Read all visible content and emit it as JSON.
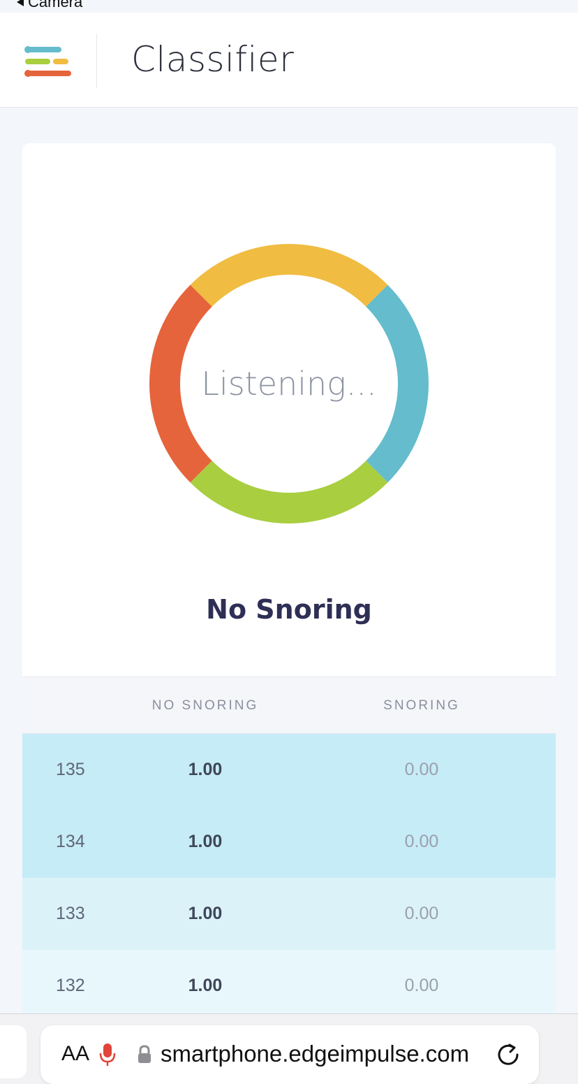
{
  "status_bar": {
    "back_label": "Camera"
  },
  "header": {
    "title": "Classifier"
  },
  "classifier": {
    "ring_text": "Listening...",
    "result_label": "No Snoring",
    "ring_colors": [
      "#f0bc41",
      "#64bccc",
      "#a9ce3f",
      "#e5643b"
    ]
  },
  "table": {
    "headers": [
      "NO SNORING",
      "SNORING"
    ],
    "rows": [
      {
        "index": "135",
        "no_snoring": "1.00",
        "snoring": "0.00",
        "bg": "#c6ecf7"
      },
      {
        "index": "134",
        "no_snoring": "1.00",
        "snoring": "0.00",
        "bg": "#c6ecf7"
      },
      {
        "index": "133",
        "no_snoring": "1.00",
        "snoring": "0.00",
        "bg": "#dcf2f9"
      },
      {
        "index": "132",
        "no_snoring": "1.00",
        "snoring": "0.00",
        "bg": "#e8f7fc"
      }
    ]
  },
  "browser": {
    "text_size_label": "AA",
    "url": "smartphone.edgeimpulse.com"
  }
}
